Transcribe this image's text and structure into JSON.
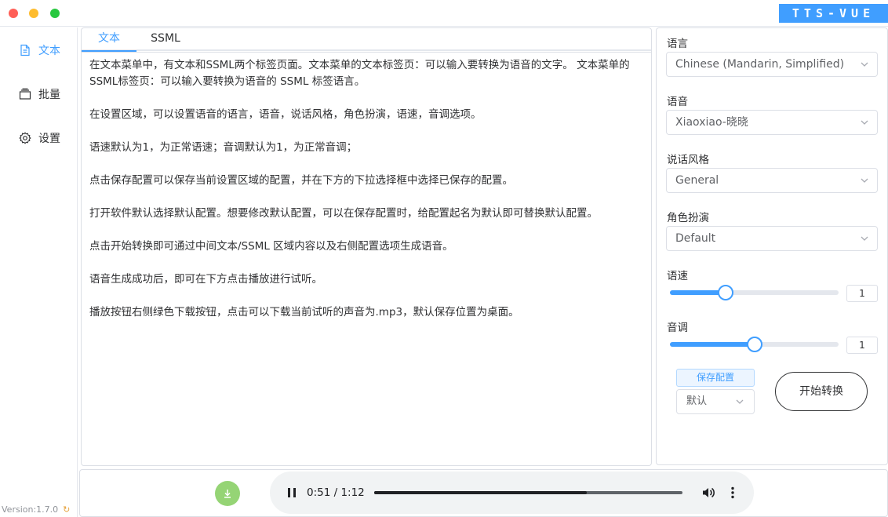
{
  "brand": "TTS-VUE",
  "colors": {
    "accent": "#409eff",
    "download": "#95d475",
    "border": "#dcdfe6"
  },
  "sidebar": {
    "items": [
      {
        "label": "文本",
        "icon": "document-icon",
        "active": true
      },
      {
        "label": "批量",
        "icon": "batch-icon",
        "active": false
      },
      {
        "label": "设置",
        "icon": "gear-icon",
        "active": false
      }
    ],
    "version": "Version:1.7.0"
  },
  "editor": {
    "tabs": [
      {
        "label": "文本",
        "active": true
      },
      {
        "label": "SSML",
        "active": false
      }
    ],
    "paragraphs": [
      "在文本菜单中，有文本和SSML两个标签页面。文本菜单的文本标签页：可以输入要转换为语音的文字。 文本菜单的SSML标签页：可以输入要转换为语音的 SSML 标签语言。",
      "在设置区域，可以设置语音的语言，语音，说话风格，角色扮演，语速，音调选项。",
      "语速默认为1，为正常语速；音调默认为1，为正常音调；",
      "点击保存配置可以保存当前设置区域的配置，并在下方的下拉选择框中选择已保存的配置。",
      "打开软件默认选择默认配置。想要修改默认配置，可以在保存配置时，给配置起名为默认即可替换默认配置。",
      "点击开始转换即可通过中间文本/SSML 区域内容以及右侧配置选项生成语音。",
      "语音生成成功后，即可在下方点击播放进行试听。",
      "播放按钮右侧绿色下载按钮，点击可以下载当前试听的声音为.mp3，默认保存位置为桌面。"
    ]
  },
  "settings": {
    "language": {
      "label": "语言",
      "value": "Chinese (Mandarin, Simplified)"
    },
    "voice": {
      "label": "语音",
      "value": "Xiaoxiao-晓晓"
    },
    "style": {
      "label": "说话风格",
      "value": "General"
    },
    "role": {
      "label": "角色扮演",
      "value": "Default"
    },
    "rate": {
      "label": "语速",
      "value": "1",
      "fraction": 0.33
    },
    "pitch": {
      "label": "音调",
      "value": "1",
      "fraction": 0.5
    },
    "save_label": "保存配置",
    "preset_value": "默认",
    "start_label": "开始转换"
  },
  "player": {
    "time": "0:51 / 1:12",
    "progress": 0.69
  }
}
